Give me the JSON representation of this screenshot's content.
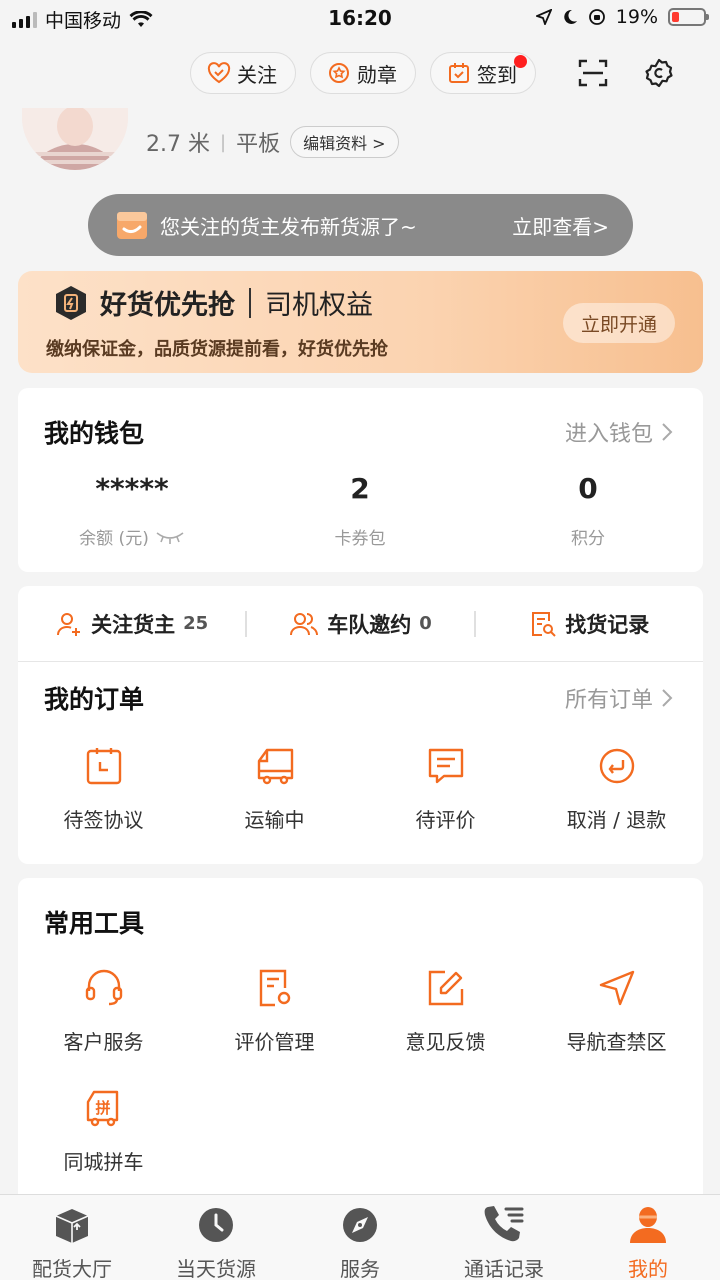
{
  "status_bar": {
    "carrier": "中国移动",
    "time": "16:20",
    "battery": "19%"
  },
  "top_actions": {
    "follow": "关注",
    "medal": "勋章",
    "checkin": "签到"
  },
  "profile": {
    "length": "2.7 米",
    "separator": "|",
    "truck_type": "平板",
    "edit": "编辑资料 >"
  },
  "toast": {
    "message": "您关注的货主发布新货源了~",
    "action": "立即查看>"
  },
  "promo": {
    "brand": "好货优先抢",
    "benefit": "司机权益",
    "subtitle": "缴纳保证金，品质货源提前看，好货优先抢",
    "button": "立即开通"
  },
  "wallet": {
    "title": "我的钱包",
    "link": "进入钱包",
    "stats": [
      {
        "value": "*****",
        "label": "余额 (元)"
      },
      {
        "value": "2",
        "label": "卡券包"
      },
      {
        "value": "0",
        "label": "积分"
      }
    ]
  },
  "quick": {
    "items": [
      {
        "label": "关注货主",
        "count": "25"
      },
      {
        "label": "车队邀约",
        "count": "0"
      },
      {
        "label": "找货记录",
        "count": ""
      }
    ]
  },
  "orders": {
    "title": "我的订单",
    "link": "所有订单",
    "items": [
      {
        "label": "待签协议",
        "icon": "clipboard-clock-icon"
      },
      {
        "label": "运输中",
        "icon": "truck-icon"
      },
      {
        "label": "待评价",
        "icon": "comment-icon"
      },
      {
        "label": "取消 / 退款",
        "icon": "return-icon"
      }
    ]
  },
  "tools": {
    "title": "常用工具",
    "items": [
      {
        "label": "客户服务",
        "icon": "headset-icon"
      },
      {
        "label": "评价管理",
        "icon": "review-doc-icon"
      },
      {
        "label": "意见反馈",
        "icon": "edit-icon"
      },
      {
        "label": "导航查禁区",
        "icon": "navigation-icon"
      },
      {
        "label": "同城拼车",
        "icon": "carpool-icon"
      }
    ]
  },
  "tabbar": {
    "items": [
      {
        "label": "配货大厅",
        "icon": "box-icon"
      },
      {
        "label": "当天货源",
        "icon": "clock-icon"
      },
      {
        "label": "服务",
        "icon": "compass-icon"
      },
      {
        "label": "通话记录",
        "icon": "phone-list-icon"
      },
      {
        "label": "我的",
        "icon": "person-icon",
        "active": true
      }
    ]
  },
  "colors": {
    "accent": "#f36b20",
    "badge": "#ff1f1f"
  }
}
